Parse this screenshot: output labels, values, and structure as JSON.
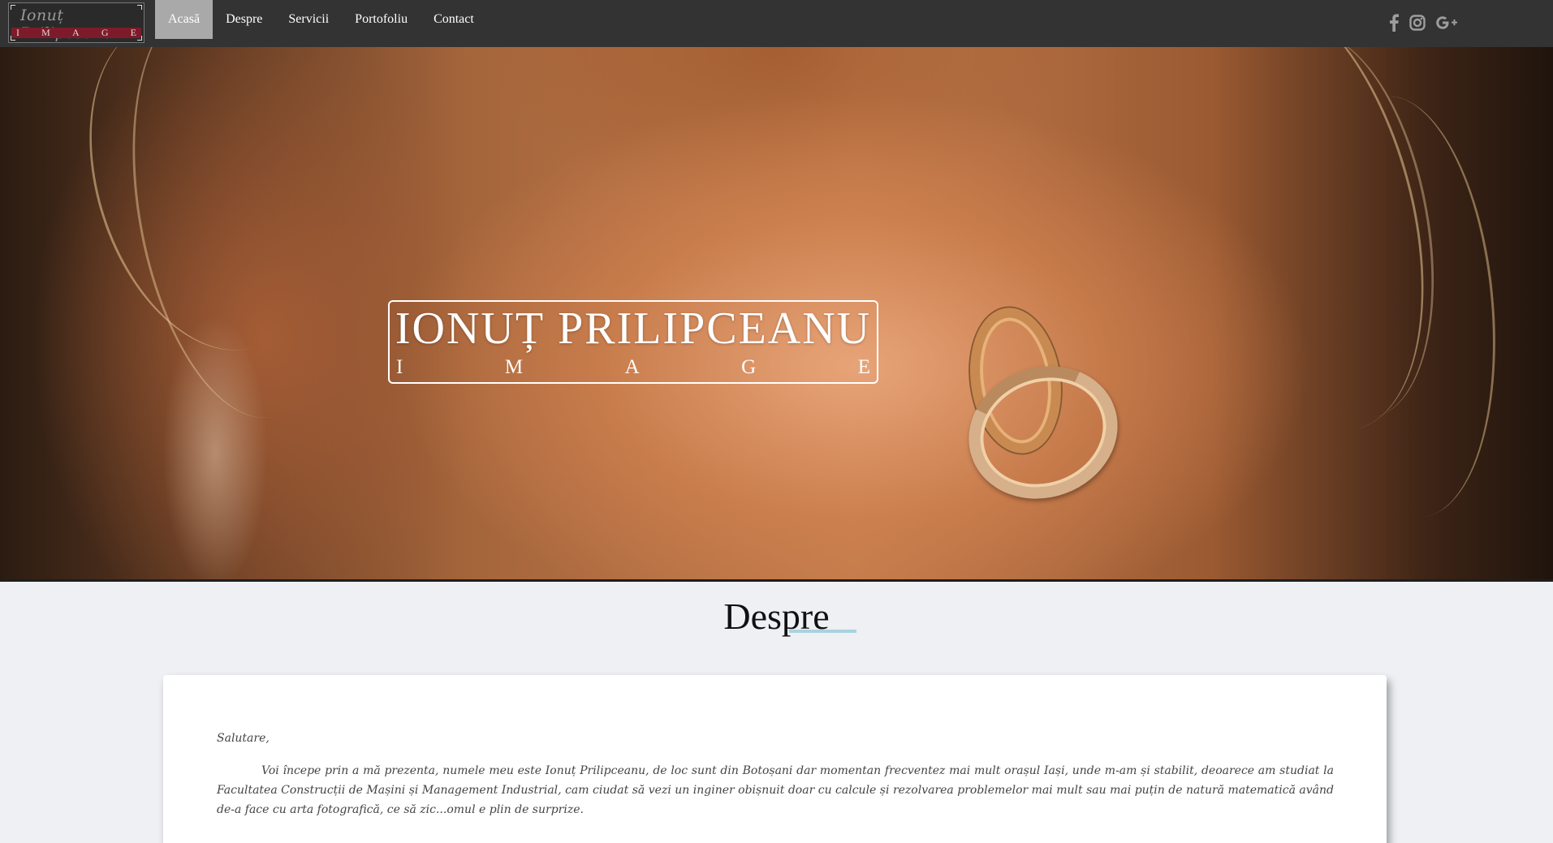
{
  "logo": {
    "script_text": "Ionuț Prilipceanu",
    "band_letters": [
      "I",
      "M",
      "A",
      "G",
      "E"
    ]
  },
  "nav": {
    "items": [
      {
        "label": "Acasă",
        "active": true
      },
      {
        "label": "Despre",
        "active": false
      },
      {
        "label": "Servicii",
        "active": false
      },
      {
        "label": "Portofoliu",
        "active": false
      },
      {
        "label": "Contact",
        "active": false
      }
    ],
    "social_icons": [
      "facebook-icon",
      "instagram-icon",
      "google-plus-icon"
    ],
    "colors": {
      "bar": "#333333",
      "active_bg": "#a9a9a9",
      "text": "#ffffff",
      "icons": "#9d9d9d"
    }
  },
  "hero": {
    "name": "IONUȚ PRILIPCEANU",
    "sub_letters": [
      "I",
      "M",
      "A",
      "G",
      "E"
    ]
  },
  "about": {
    "title": "Despre",
    "accent_color": "#a9d3e0",
    "greeting": "Salutare,",
    "paragraph": "Voi începe prin a mă prezenta, numele meu este Ionuț Prilipceanu, de loc sunt din Botoșani dar momentan frecventez mai mult orașul Iași, unde m-am și stabilit, deoarece am studiat la Facultatea Construcții de Mașini și Management Industrial, cam ciudat să vezi un inginer obișnuit doar cu calcule și rezolvarea problemelor mai mult sau mai puțin de natură matematică având de-a face cu arta fotografică, ce să zic...omul e plin de surprize."
  }
}
